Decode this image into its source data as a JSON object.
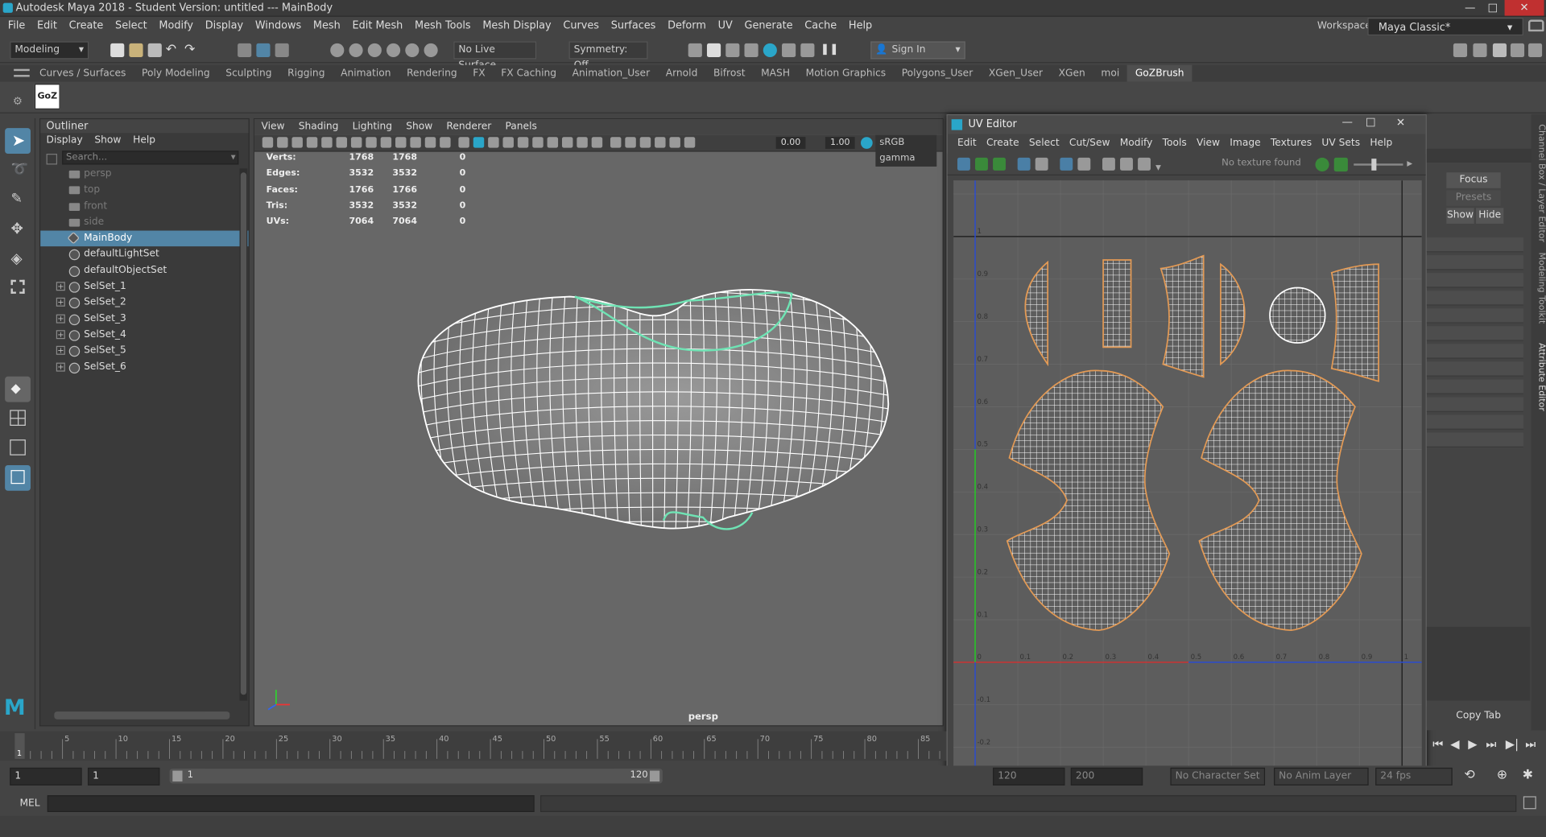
{
  "window": {
    "title": "Autodesk Maya 2018 - Student Version: untitled   ---   MainBody",
    "minimize": "—",
    "maximize": "□",
    "close": "✕"
  },
  "menubar": [
    "File",
    "Edit",
    "Create",
    "Select",
    "Modify",
    "Display",
    "Windows",
    "Mesh",
    "Edit Mesh",
    "Mesh Tools",
    "Mesh Display",
    "Curves",
    "Surfaces",
    "Deform",
    "UV",
    "Generate",
    "Cache",
    "Help"
  ],
  "workspace": {
    "label": "Workspace :",
    "value": "Maya Classic*"
  },
  "statusline": {
    "mode": "Modeling",
    "live_surface": "No Live Surface",
    "symmetry": "Symmetry: Off",
    "sign_in": "Sign In"
  },
  "shelf_tabs": [
    "Curves / Surfaces",
    "Poly Modeling",
    "Sculpting",
    "Rigging",
    "Animation",
    "Rendering",
    "FX",
    "FX Caching",
    "Animation_User",
    "Arnold",
    "Bifrost",
    "MASH",
    "Motion Graphics",
    "Polygons_User",
    "XGen_User",
    "XGen",
    "moi",
    "GoZBrush"
  ],
  "shelf_active": "GoZBrush",
  "shelf_icon_label": "GoZ",
  "outliner": {
    "title": "Outliner",
    "menu": [
      "Display",
      "Show",
      "Help"
    ],
    "search_placeholder": "Search...",
    "items": [
      {
        "label": "persp",
        "kind": "camera",
        "dim": true
      },
      {
        "label": "top",
        "kind": "camera",
        "dim": true
      },
      {
        "label": "front",
        "kind": "camera",
        "dim": true
      },
      {
        "label": "side",
        "kind": "camera",
        "dim": true
      },
      {
        "label": "MainBody",
        "kind": "mesh",
        "selected": true
      },
      {
        "label": "defaultLightSet",
        "kind": "set"
      },
      {
        "label": "defaultObjectSet",
        "kind": "set"
      },
      {
        "label": "SelSet_1",
        "kind": "set",
        "expand": true
      },
      {
        "label": "SelSet_2",
        "kind": "set",
        "expand": true
      },
      {
        "label": "SelSet_3",
        "kind": "set",
        "expand": true
      },
      {
        "label": "SelSet_4",
        "kind": "set",
        "expand": true
      },
      {
        "label": "SelSet_5",
        "kind": "set",
        "expand": true
      },
      {
        "label": "SelSet_6",
        "kind": "set",
        "expand": true
      }
    ]
  },
  "viewport": {
    "menu": [
      "View",
      "Shading",
      "Lighting",
      "Show",
      "Renderer",
      "Panels"
    ],
    "exposure": "0.00",
    "gamma": "1.00",
    "colorspace": "sRGB gamma",
    "camera_label": "persp",
    "hud": [
      {
        "label": "Verts:",
        "a": "1768",
        "b": "1768",
        "c": "0"
      },
      {
        "label": "Edges:",
        "a": "3532",
        "b": "3532",
        "c": "0"
      },
      {
        "label": "Faces:",
        "a": "1766",
        "b": "1766",
        "c": "0"
      },
      {
        "label": "Tris:",
        "a": "3532",
        "b": "3532",
        "c": "0"
      },
      {
        "label": "UVs:",
        "a": "7064",
        "b": "7064",
        "c": "0"
      }
    ],
    "wire_color": "#ffffff",
    "seam_color": "#6fe3b4"
  },
  "uv_editor": {
    "title": "UV Editor",
    "menu": [
      "Edit",
      "Create",
      "Select",
      "Cut/Sew",
      "Modify",
      "Tools",
      "View",
      "Image",
      "Textures",
      "UV Sets",
      "Help"
    ],
    "texture_status": "No texture found",
    "u_ticks": [
      "0",
      "0.1",
      "0.2",
      "0.3",
      "0.4",
      "0.5",
      "0.6",
      "0.7",
      "0.8",
      "0.9",
      "1"
    ],
    "v_ticks": [
      "1",
      "0.9",
      "0.8",
      "0.7",
      "0.6",
      "0.5",
      "0.4",
      "0.3",
      "0.2",
      "0.1"
    ],
    "v_neg_ticks": [
      "-0.1",
      "-0.2"
    ],
    "shell_border_color": "#e39a55"
  },
  "right_panel": {
    "focus": "Focus",
    "presets": "Presets",
    "show": "Show",
    "hide": "Hide",
    "copy_tab": "Copy Tab"
  },
  "side_tabs": [
    "Channel Box / Layer Editor",
    "Modeling Toolkit",
    "Attribute Editor"
  ],
  "timeslider": {
    "ticks": [
      "5",
      "10",
      "15",
      "20",
      "25",
      "30",
      "35",
      "40",
      "45",
      "50",
      "55",
      "60",
      "65",
      "70",
      "75",
      "80",
      "85"
    ],
    "current_frame": "1"
  },
  "range": {
    "start": "1",
    "playback_start": "1",
    "range_start": "1",
    "range_end": "120",
    "end": "120",
    "anim_end": "200",
    "char_set": "No Character Set",
    "anim_layer": "No Anim Layer",
    "fps": "24 fps"
  },
  "cmdline": {
    "label": "MEL"
  }
}
